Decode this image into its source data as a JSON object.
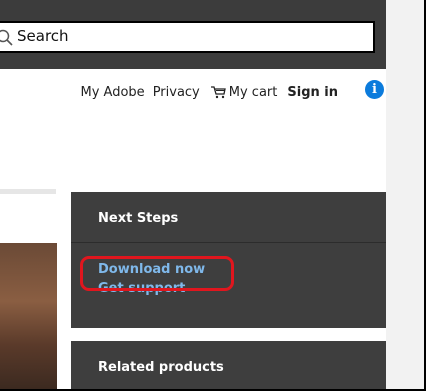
{
  "search": {
    "placeholder": "Search"
  },
  "nav": {
    "my_adobe": "My Adobe",
    "privacy": "Privacy",
    "cart": "My cart",
    "sign_in": "Sign in",
    "info_glyph": "i"
  },
  "next_steps": {
    "title": "Next Steps",
    "links": [
      "Download now",
      "Get support"
    ]
  },
  "related_products": {
    "title": "Related products"
  },
  "colors": {
    "panel_bg": "#3e3e3e",
    "link": "#7fb8ea",
    "highlight": "#e0161e",
    "info_icon": "#0b7bdc"
  }
}
